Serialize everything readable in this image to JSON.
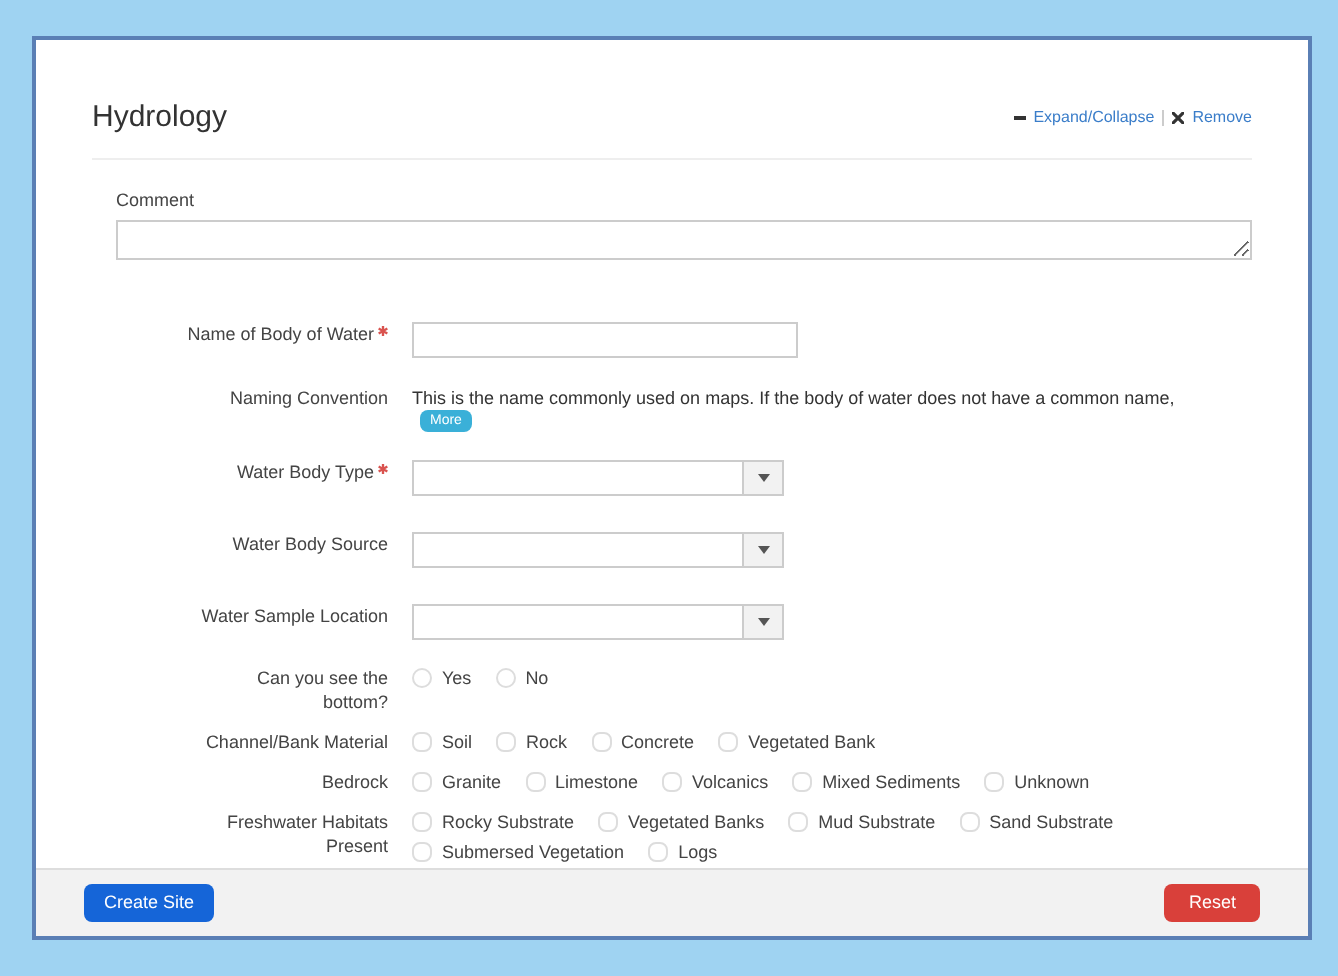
{
  "panel": {
    "title": "Hydrology",
    "actions": [
      {
        "kind": "collapse",
        "label": "Expand/Collapse"
      },
      {
        "kind": "remove",
        "label": "Remove"
      }
    ]
  },
  "comment": {
    "label": "Comment"
  },
  "fields": [
    {
      "kind": "text",
      "label": "Name of Body of Water",
      "required": true
    },
    {
      "kind": "info",
      "label": "Naming Convention",
      "text": "This is the name commonly used on maps. If the body of water does not have a common name,",
      "button": "More"
    },
    {
      "kind": "select",
      "label": "Water Body Type",
      "required": true
    },
    {
      "kind": "select",
      "label": "Water Body Source",
      "required": false
    },
    {
      "kind": "select",
      "label": "Water Sample Location",
      "required": false
    },
    {
      "kind": "radio",
      "label": "Can you see the bottom?",
      "options": [
        {
          "label": "Yes",
          "selected": false
        },
        {
          "label": "No",
          "selected": false
        }
      ]
    },
    {
      "kind": "checkbox",
      "label": "Channel/Bank Material",
      "options": [
        {
          "label": "Soil",
          "checked": false
        },
        {
          "label": "Rock",
          "checked": false
        },
        {
          "label": "Concrete",
          "checked": false
        },
        {
          "label": "Vegetated Bank",
          "checked": false
        }
      ]
    },
    {
      "kind": "checkbox",
      "label": "Bedrock",
      "options": [
        {
          "label": "Granite",
          "checked": false
        },
        {
          "label": "Limestone",
          "checked": false
        },
        {
          "label": "Volcanics",
          "checked": false
        },
        {
          "label": "Mixed Sediments",
          "checked": false
        },
        {
          "label": "Unknown",
          "checked": false
        }
      ]
    },
    {
      "kind": "checkbox",
      "label": "Freshwater Habitats Present",
      "options": [
        {
          "label": "Rocky Substrate",
          "checked": false
        },
        {
          "label": "Vegetated Banks",
          "checked": false
        },
        {
          "label": "Mud Substrate",
          "checked": false
        },
        {
          "label": "Sand Substrate",
          "checked": false
        },
        {
          "label": "Submersed Vegetation",
          "checked": false
        },
        {
          "label": "Logs",
          "checked": false
        }
      ]
    }
  ],
  "footer": {
    "submit": "Create Site",
    "reset": "Reset"
  }
}
